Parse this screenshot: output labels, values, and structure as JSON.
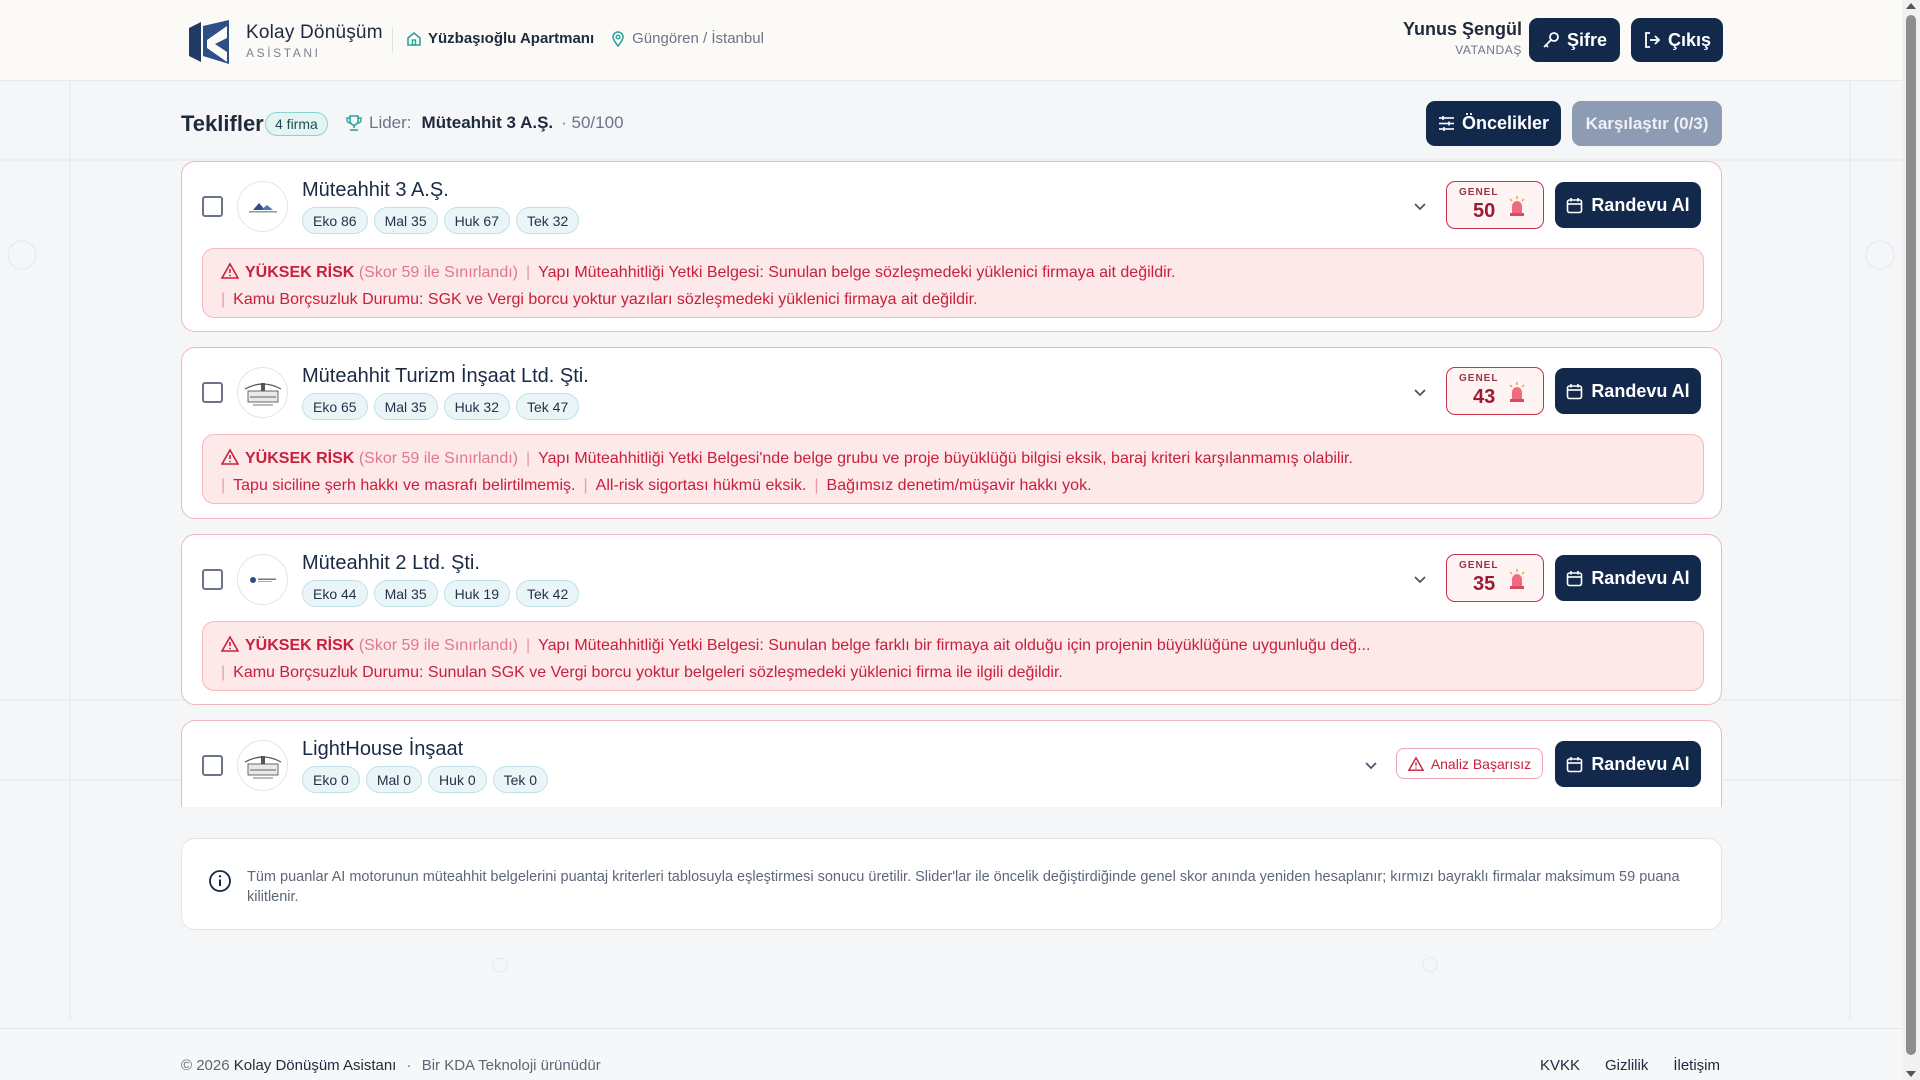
{
  "brand": {
    "name": "Kolay Dönüşüm",
    "sub": "ASİSTANI"
  },
  "location": {
    "apartment": "Yüzbaşıoğlu Apartmanı",
    "city": "Güngören / İstanbul"
  },
  "user": {
    "name": "Yunus Şengül",
    "role": "VATANDAŞ"
  },
  "header_buttons": {
    "password": "Şifre",
    "logout": "Çıkış"
  },
  "toolbar": {
    "title": "Teklifler",
    "count": "4 firma",
    "leader_label": "Lider:",
    "leader_name": "Müteahhit 3 A.Ş.",
    "leader_score": "· 50/100",
    "priorities": "Öncelikler",
    "compare": "Karşılaştır (0/3)"
  },
  "colors": {
    "primary": "#13294b",
    "risk": "#c8203c",
    "accent": "#8fd1cc"
  },
  "offers": [
    {
      "name": "Müteahhit 3 A.Ş.",
      "chips": [
        "Eko 86",
        "Mal 35",
        "Huk 67",
        "Tek 32"
      ],
      "score_label": "GENEL",
      "score": "50",
      "cta": "Randevu Al",
      "risk": {
        "level": "YÜKSEK RİSK",
        "note": "(Skor 59 ile Sınırlandı)",
        "line1": "Yapı Müteahhitliği Yetki Belgesi: Sunulan belge sözleşmedeki yüklenici firmaya ait değildir.",
        "line2": "Kamu Borçsuzluk Durumu: SGK ve Vergi borcu yoktur yazıları sözleşmedeki yüklenici firmaya ait değildir."
      }
    },
    {
      "name": "Müteahhit Turizm İnşaat Ltd. Şti.",
      "chips": [
        "Eko 65",
        "Mal 35",
        "Huk 32",
        "Tek 47"
      ],
      "score_label": "GENEL",
      "score": "43",
      "cta": "Randevu Al",
      "risk": {
        "level": "YÜKSEK RİSK",
        "note": "(Skor 59 ile Sınırlandı)",
        "line1": "Yapı Müteahhitliği Yetki Belgesi'nde belge grubu ve proje büyüklüğü bilgisi eksik, baraj kriteri karşılanmamış olabilir.",
        "line2a": "Tapu siciline şerh hakkı ve masrafı belirtilmemiş.",
        "line2b": "All-risk sigortası hükmü eksik.",
        "line2c": "Bağımsız denetim/müşavir hakkı yok."
      }
    },
    {
      "name": "Müteahhit 2 Ltd. Şti.",
      "chips": [
        "Eko 44",
        "Mal 35",
        "Huk 19",
        "Tek 42"
      ],
      "score_label": "GENEL",
      "score": "35",
      "cta": "Randevu Al",
      "risk": {
        "level": "YÜKSEK RİSK",
        "note": "(Skor 59 ile Sınırlandı)",
        "line1": "Yapı Müteahhitliği Yetki Belgesi: Sunulan belge farklı bir firmaya ait olduğu için projenin büyüklüğüne uygunluğu değ...",
        "line2": "Kamu Borçsuzluk Durumu: Sunulan SGK ve Vergi borcu yoktur belgeleri sözleşmedeki yüklenici firma ile ilgili değildir."
      }
    },
    {
      "name": "LightHouse İnşaat",
      "chips": [
        "Eko 0",
        "Mal 0",
        "Huk 0",
        "Tek 0"
      ],
      "status": "Analiz Başarısız",
      "cta": "Randevu Al"
    }
  ],
  "info_text": "Tüm puanlar AI motorunun müteahhit belgelerini puantaj kriterleri tablosuyla eşleştirmesi sonucu üretilir. Slider'lar ile öncelik değiştirdiğinde genel skor anında yeniden hesaplanır; kırmızı bayraklı firmalar maksimum 59 puana kilitlenir.",
  "footer": {
    "copyright": "© 2026",
    "brand": "Kolay Dönüşüm Asistanı",
    "separator": "·",
    "tagline": "Bir KDA Teknoloji ürünüdür",
    "links": [
      "KVKK",
      "Gizlilik",
      "İletişim"
    ]
  }
}
